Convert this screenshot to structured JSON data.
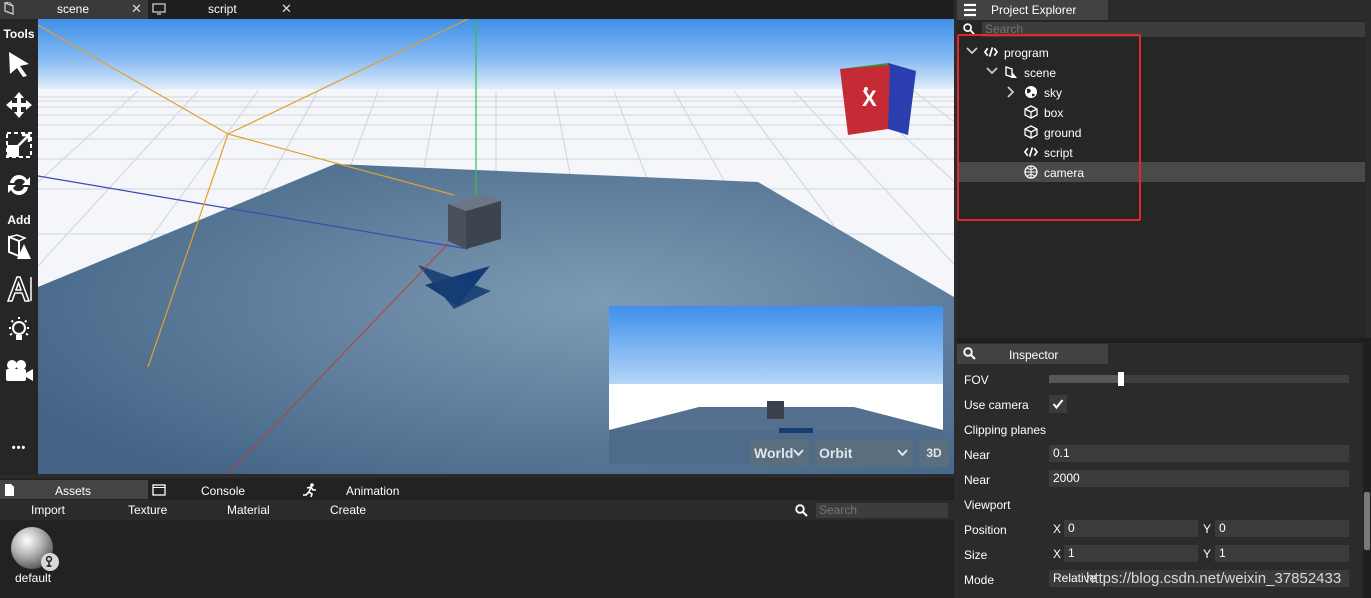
{
  "top_tabs": [
    {
      "label": "scene",
      "close": "✕"
    },
    {
      "label": "script",
      "close": "✕"
    }
  ],
  "toolbar": {
    "tools_label": "Tools",
    "add_label": "Add",
    "more_label": "•••"
  },
  "viewport": {
    "gizmo_label": "X",
    "space_select": "World",
    "camera_mode_select": "Orbit",
    "view_toggle": "3D"
  },
  "assets_panel": {
    "tabs": [
      "Assets",
      "Console",
      "Animation"
    ],
    "actions": [
      "Import",
      "Texture",
      "Material",
      "Create"
    ],
    "search_placeholder": "Search",
    "items": [
      {
        "label": "default"
      }
    ]
  },
  "project_explorer": {
    "title": "Project Explorer",
    "search_placeholder": "Search",
    "tree": [
      {
        "label": "program",
        "expanded": true
      },
      {
        "label": "scene",
        "expanded": true
      },
      {
        "label": "sky",
        "collapsed": true
      },
      {
        "label": "box"
      },
      {
        "label": "ground"
      },
      {
        "label": "script"
      },
      {
        "label": "camera",
        "selected": true
      }
    ]
  },
  "inspector": {
    "title": "Inspector",
    "fov_label": "FOV",
    "fov_level": 0.35,
    "use_camera_label": "Use camera",
    "use_camera_checked": true,
    "clipping_label": "Clipping planes",
    "near_label": "Near",
    "near_value": "0.1",
    "far_label": "Near",
    "far_value": "2000",
    "viewport_label": "Viewport",
    "position_label": "Position",
    "position_x_label": "X",
    "position_x": "0",
    "position_y_label": "Y",
    "position_y": "0",
    "size_label": "Size",
    "size_x_label": "X",
    "size_x": "1",
    "size_y_label": "Y",
    "size_y": "1",
    "mode_label": "Mode",
    "mode_value": "Relative"
  },
  "watermark": "https://blog.csdn.net/weixin_37852433",
  "colors": {
    "highlight_box": "#e0282e",
    "selected_row": "#4a4a4a",
    "sky_top": "#3d8ee8",
    "ground": "#4a6a8e"
  }
}
